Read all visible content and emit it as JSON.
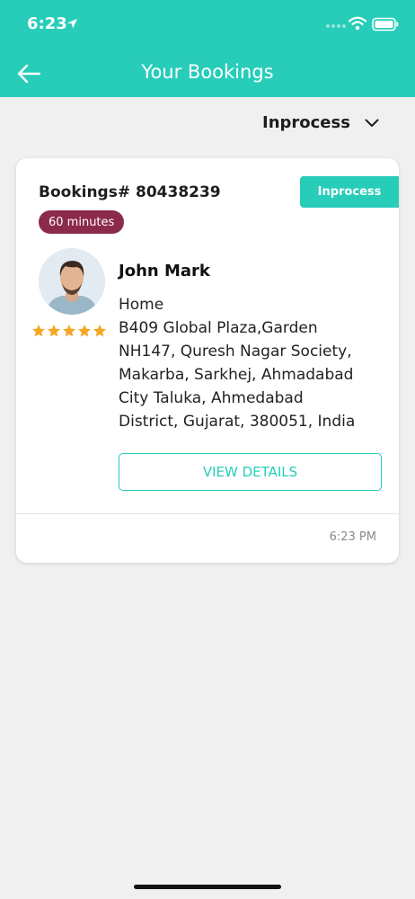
{
  "status_bar": {
    "time": "6:23"
  },
  "header": {
    "title": "Your Bookings"
  },
  "filter": {
    "selected": "Inprocess"
  },
  "booking": {
    "id_text": "Bookings# 80438239",
    "status": "Inprocess",
    "duration": "60 minutes",
    "customer_name": "John Mark",
    "rating": 5,
    "address_type": "Home",
    "address_lines": [
      "B409 Global Plaza,Garden",
      "NH147, Quresh Nagar Society,",
      "Makarba, Sarkhej, Ahmadabad",
      "City Taluka, Ahmedabad",
      "District, Gujarat, 380051, India"
    ],
    "view_details_label": "VIEW DETAILS",
    "time": "6:23 PM"
  },
  "colors": {
    "accent": "#27cdb9",
    "duration_badge": "#8c2a4d",
    "star": "#f5a623",
    "background": "#f0f0f0"
  }
}
